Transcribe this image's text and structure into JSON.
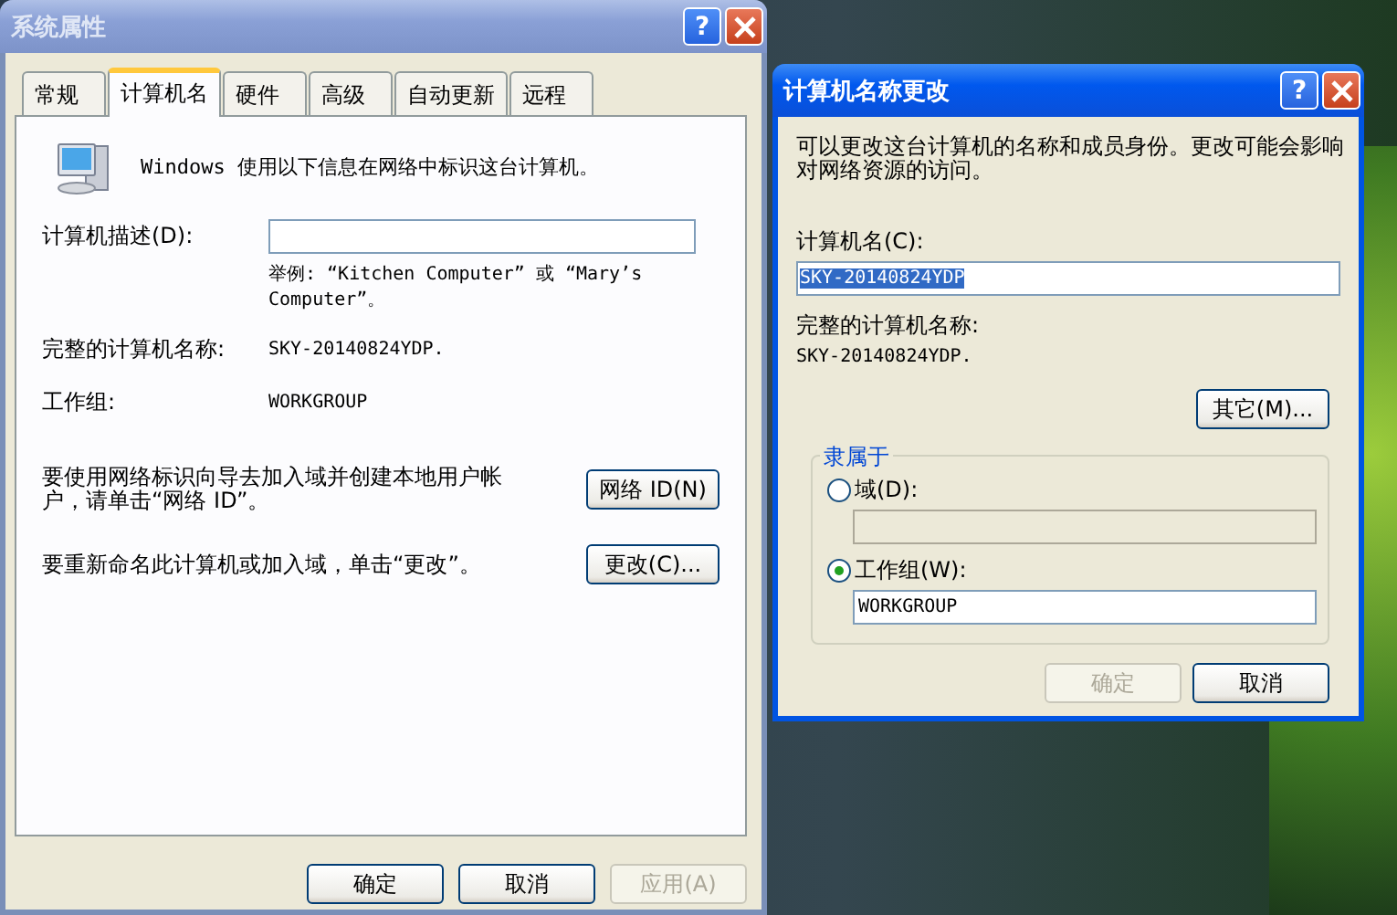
{
  "system_properties": {
    "title": "系统属性",
    "help_glyph": "?",
    "tabs": [
      {
        "label": "常规",
        "selected": false
      },
      {
        "label": "计算机名",
        "selected": true
      },
      {
        "label": "硬件",
        "selected": false
      },
      {
        "label": "高级",
        "selected": false
      },
      {
        "label": "自动更新",
        "selected": false
      },
      {
        "label": "远程",
        "selected": false
      }
    ],
    "intro": "Windows 使用以下信息在网络中标识这台计算机。",
    "description_label": "计算机描述(D):",
    "example": "举例: “Kitchen Computer” 或 “Mary’s Computer”。",
    "full_name_label": "完整的计算机名称:",
    "full_name": "SKY-20140824YDP.",
    "workgroup_label": "工作组:",
    "workgroup": "WORKGROUP",
    "network_text": "要使用网络标识向导去加入域并创建本地用户帐户，请单击“网络 ID”。",
    "network_button": "网络 ID(N)",
    "rename_text": "要重新命名此计算机或加入域，单击“更改”。",
    "rename_button": "更改(C)...",
    "buttons": [
      {
        "label": "确定",
        "disabled": false
      },
      {
        "label": "取消",
        "disabled": false
      },
      {
        "label": "应用(A)",
        "disabled": true
      }
    ]
  },
  "name_change": {
    "title": "计算机名称更改",
    "help_glyph": "?",
    "intro": "可以更改这台计算机的名称和成员身份。更改可能会影响对网络资源的访问。",
    "name_label": "计算机名(C):",
    "name_value": "SKY-20140824YDP",
    "name_selected": true,
    "full_name_label": "完整的计算机名称:",
    "full_name": "SKY-20140824YDP.",
    "more_button": "其它(M)...",
    "group_title": "隶属于",
    "options": [
      {
        "label": "域(D):",
        "selected": false
      },
      {
        "label": "工作组(W):",
        "selected": true,
        "value": "WORKGROUP"
      }
    ],
    "buttons": [
      {
        "label": "确定",
        "disabled": true
      },
      {
        "label": "取消",
        "disabled": false
      }
    ]
  }
}
